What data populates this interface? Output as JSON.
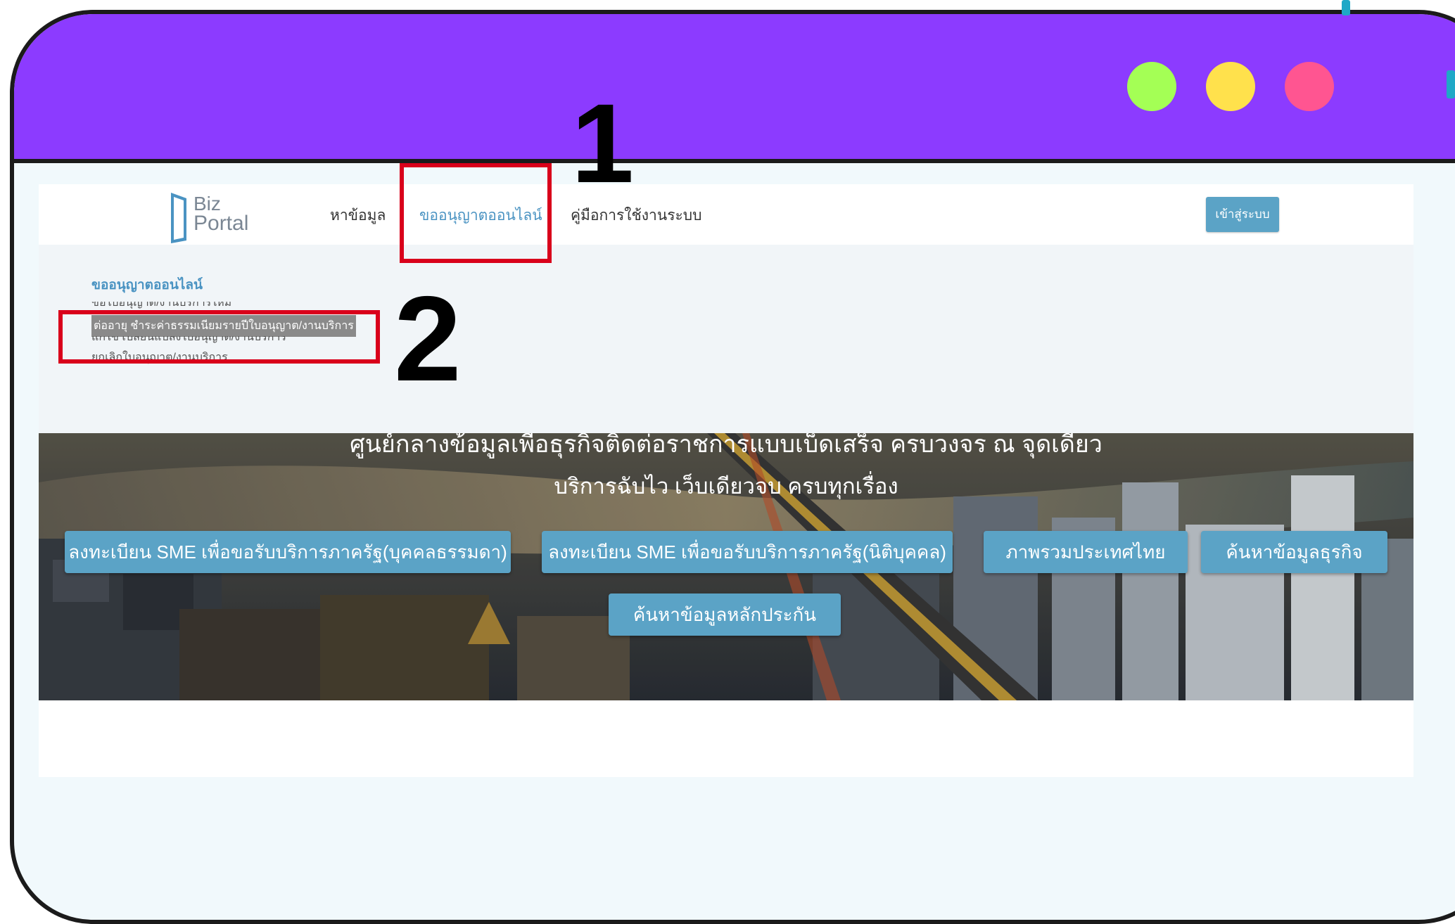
{
  "window": {
    "dots": [
      "green",
      "yellow",
      "pink"
    ],
    "colors": {
      "titlebar": "#8c3bff",
      "dot_green": "#a4ff55",
      "dot_yellow": "#ffe14c",
      "dot_pink": "#ff5591"
    }
  },
  "navbar": {
    "logo_line1": "Biz",
    "logo_line2": "Portal",
    "links": [
      "หาข้อมูล",
      "ขออนุญาตออนไลน์",
      "คู่มือการใช้งานระบบ"
    ],
    "login": "เข้าสู่ระบบ"
  },
  "dropdown": {
    "title": "ขออนุญาตออนไลน์",
    "items": [
      "ขอใบอนุญาต/งานบริการใหม่",
      "ต่ออายุ ชำระค่าธรรมเนียมรายปีใบอนุญาต/งานบริการ",
      "แก้ไข เปลี่ยนแปลงใบอนุญาต/งานบริการ",
      "ยกเลิกใบอนุญาต/งานบริการ"
    ]
  },
  "hero": {
    "title": "ศูนย์กลางข้อมูลเพื่อธุรกิจติดต่อราชการแบบเบ็ดเสร็จ ครบวงจร ณ จุดเดียว",
    "subtitle": "บริการฉับไว เว็บเดียวจบ ครบทุกเรื่อง",
    "buttons": [
      "ลงทะเบียน SME เพื่อขอรับบริการภาครัฐ(บุคคลธรรมดา)",
      "ลงทะเบียน SME เพื่อขอรับบริการภาครัฐ(นิติบุคคล)",
      "ภาพรวมประเทศไทย",
      "ค้นหาข้อมูลธุรกิจ",
      "ค้นหาข้อมูลหลักประกัน"
    ]
  },
  "annotations": {
    "step1": "1",
    "step2": "2",
    "box_color": "#d9001b"
  }
}
